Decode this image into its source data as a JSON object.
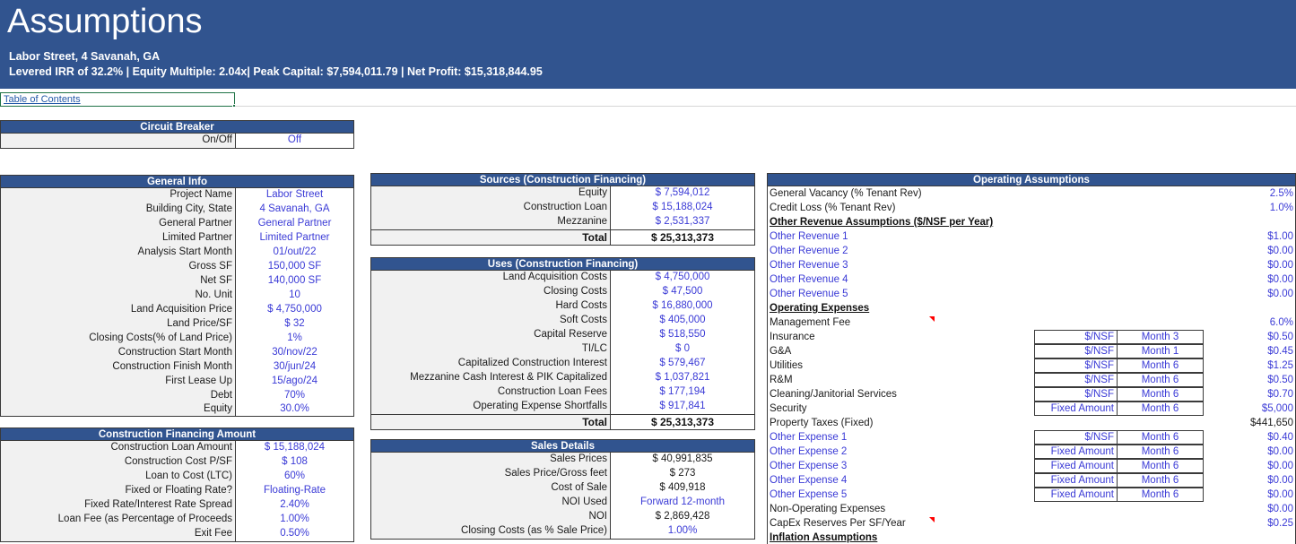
{
  "banner": {
    "title": "Assumptions",
    "address": "Labor Street, 4 Savanah, GA",
    "metrics": "Levered IRR of 32.2% | Equity Multiple: 2.04x| Peak Capital: $7,594,011.79 | Net Profit: $15,318,844.95"
  },
  "toc": {
    "link": "Table of Contents"
  },
  "circuit_breaker": {
    "title": "Circuit Breaker",
    "rows": [
      {
        "label": "On/Off",
        "value": "Off"
      }
    ]
  },
  "general_info": {
    "title": "General Info",
    "rows": [
      {
        "label": "Project Name",
        "value": "Labor Street"
      },
      {
        "label": "Building City, State",
        "value": "4 Savanah, GA"
      },
      {
        "label": "General Partner",
        "value": "General Partner"
      },
      {
        "label": "Limited Partner",
        "value": "Limited Partner"
      },
      {
        "label": "Analysis Start Month",
        "value": "01/out/22"
      },
      {
        "label": "Gross SF",
        "value": "150,000 SF"
      },
      {
        "label": "Net SF",
        "value": "140,000 SF"
      },
      {
        "label": "No. Unit",
        "value": "10"
      },
      {
        "label": "Land Acquisition Price",
        "value": "$ 4,750,000"
      },
      {
        "label": "Land Price/SF",
        "value": "$ 32"
      },
      {
        "label": "Closing Costs(% of Land Price)",
        "value": "1%"
      },
      {
        "label": "Construction Start Month",
        "value": "30/nov/22"
      },
      {
        "label": "Construction Finish Month",
        "value": "30/jun/24"
      },
      {
        "label": "First Lease Up",
        "value": "15/ago/24"
      },
      {
        "label": "Debt",
        "value": "70%"
      },
      {
        "label": "Equity",
        "value": "30.0%"
      }
    ]
  },
  "construction_financing": {
    "title": "Construction Financing Amount",
    "rows": [
      {
        "label": "Construction Loan Amount",
        "value": "$ 15,188,024"
      },
      {
        "label": "Construction Cost P/SF",
        "value": "$ 108"
      },
      {
        "label": "Loan to Cost (LTC)",
        "value": "60%"
      },
      {
        "label": "Fixed or Floating Rate?",
        "value": "Floating-Rate"
      },
      {
        "label": "Fixed Rate/Interest Rate Spread",
        "value": "2.40%"
      },
      {
        "label": "Loan Fee (as Percentage of Proceeds",
        "value": "1.00%"
      },
      {
        "label": "Exit Fee",
        "value": "0.50%"
      }
    ]
  },
  "sources": {
    "title": "Sources (Construction Financing)",
    "rows": [
      {
        "label": "Equity",
        "value": "$ 7,594,012"
      },
      {
        "label": "Construction Loan",
        "value": "$ 15,188,024"
      },
      {
        "label": "Mezzanine",
        "value": "$ 2,531,337"
      }
    ],
    "total_label": "Total",
    "total_value": "$ 25,313,373"
  },
  "uses": {
    "title": "Uses (Construction Financing)",
    "rows": [
      {
        "label": "Land Acquisition Costs",
        "value": "$ 4,750,000"
      },
      {
        "label": "Closing Costs",
        "value": "$ 47,500"
      },
      {
        "label": "Hard Costs",
        "value": "$ 16,880,000"
      },
      {
        "label": "Soft Costs",
        "value": "$ 405,000"
      },
      {
        "label": "Capital Reserve",
        "value": "$ 518,550"
      },
      {
        "label": "TI/LC",
        "value": "$ 0"
      },
      {
        "label": "Capitalized Construction Interest",
        "value": "$ 579,467"
      },
      {
        "label": "Mezzanine Cash Interest & PIK Capitalized",
        "value": "$ 1,037,821"
      },
      {
        "label": "Construction Loan Fees",
        "value": "$ 177,194"
      },
      {
        "label": "Operating Expense Shortfalls",
        "value": "$ 917,841"
      }
    ],
    "total_label": "Total",
    "total_value": "$ 25,313,373"
  },
  "sales_details": {
    "title": "Sales Details",
    "rows": [
      {
        "label": "Sales Prices",
        "value": "$ 40,991,835",
        "blue": false
      },
      {
        "label": "Sales Price/Gross feet",
        "value": "$ 273",
        "blue": false
      },
      {
        "label": "Cost of Sale",
        "value": "$ 409,918",
        "blue": false
      },
      {
        "label": "NOI Used",
        "value": "Forward 12-month",
        "blue": true
      },
      {
        "label": "NOI",
        "value": "$ 2,869,428",
        "blue": false
      },
      {
        "label": "Closing Costs (as % Sale Price)",
        "value": "1.00%",
        "blue": true
      }
    ]
  },
  "operating_assumptions": {
    "title": "Operating Assumptions",
    "rows": [
      {
        "kind": "value",
        "label": "General Vacancy (% Tenant Rev)",
        "label_blue": false,
        "value": "2.5%"
      },
      {
        "kind": "value",
        "label": "Credit Loss (% Tenant Rev)",
        "label_blue": false,
        "value": "1.0%"
      },
      {
        "kind": "section",
        "label": "Other  Revenue Assumptions ($/NSF per Year)"
      },
      {
        "kind": "value",
        "label": "Other Revenue 1",
        "label_blue": true,
        "value": "$1.00"
      },
      {
        "kind": "value",
        "label": "Other Revenue 2",
        "label_blue": true,
        "value": "$0.00"
      },
      {
        "kind": "value",
        "label": "Other Revenue 3",
        "label_blue": true,
        "value": "$0.00"
      },
      {
        "kind": "value",
        "label": "Other Revenue 4",
        "label_blue": true,
        "value": "$0.00"
      },
      {
        "kind": "value",
        "label": "Other Revenue 5",
        "label_blue": true,
        "value": "$0.00"
      },
      {
        "kind": "section",
        "label": "Operating Expenses"
      },
      {
        "kind": "value",
        "label": "Management Fee",
        "label_blue": false,
        "value": "6.0%",
        "comment": true
      },
      {
        "kind": "dd",
        "label": "Insurance",
        "label_blue": false,
        "basis": "$/NSF",
        "timing": "Month 3",
        "value": "$0.50"
      },
      {
        "kind": "dd",
        "label": "G&A",
        "label_blue": false,
        "basis": "$/NSF",
        "timing": "Month 1",
        "value": "$0.45"
      },
      {
        "kind": "dd",
        "label": "Utilities",
        "label_blue": false,
        "basis": "$/NSF",
        "timing": "Month 6",
        "value": "$1.25"
      },
      {
        "kind": "dd",
        "label": "R&M",
        "label_blue": false,
        "basis": "$/NSF",
        "timing": "Month 6",
        "value": "$0.50"
      },
      {
        "kind": "dd",
        "label": "Cleaning/Janitorial Services",
        "label_blue": false,
        "basis": "$/NSF",
        "timing": "Month 6",
        "value": "$0.70"
      },
      {
        "kind": "dd",
        "label": "Security",
        "label_blue": false,
        "basis": "Fixed Amount",
        "timing": "Month 6",
        "value": "$5,000"
      },
      {
        "kind": "value",
        "label": "Property Taxes (Fixed)",
        "label_blue": false,
        "value": "$441,650",
        "value_dark": true
      },
      {
        "kind": "dd",
        "label": "Other Expense 1",
        "label_blue": true,
        "basis": "$/NSF",
        "timing": "Month 6",
        "value": "$0.40"
      },
      {
        "kind": "dd",
        "label": "Other Expense 2",
        "label_blue": true,
        "basis": "Fixed Amount",
        "timing": "Month 6",
        "value": "$0.00"
      },
      {
        "kind": "dd",
        "label": "Other Expense 3",
        "label_blue": true,
        "basis": "Fixed Amount",
        "timing": "Month 6",
        "value": "$0.00"
      },
      {
        "kind": "dd",
        "label": "Other Expense 4",
        "label_blue": true,
        "basis": "Fixed Amount",
        "timing": "Month 6",
        "value": "$0.00"
      },
      {
        "kind": "dd",
        "label": "Other Expense 5",
        "label_blue": true,
        "basis": "Fixed Amount",
        "timing": "Month 6",
        "value": "$0.00"
      },
      {
        "kind": "value",
        "label": "Non-Operating Expenses",
        "label_blue": false,
        "value": "$0.00"
      },
      {
        "kind": "value",
        "label": "CapEx Reserves Per SF/Year",
        "label_blue": false,
        "value": "$0.25",
        "comment": true
      },
      {
        "kind": "section",
        "label": "Inflation Assumptions "
      }
    ]
  },
  "colors": {
    "header_blue": "#31548F",
    "input_blue": "#3A3AD6",
    "link_blue": "#2459A8",
    "label_gray": "#F1F1F1",
    "grid": "#3A3A3A",
    "comment_red": "#FF0000",
    "selection_green": "#1F7246"
  }
}
